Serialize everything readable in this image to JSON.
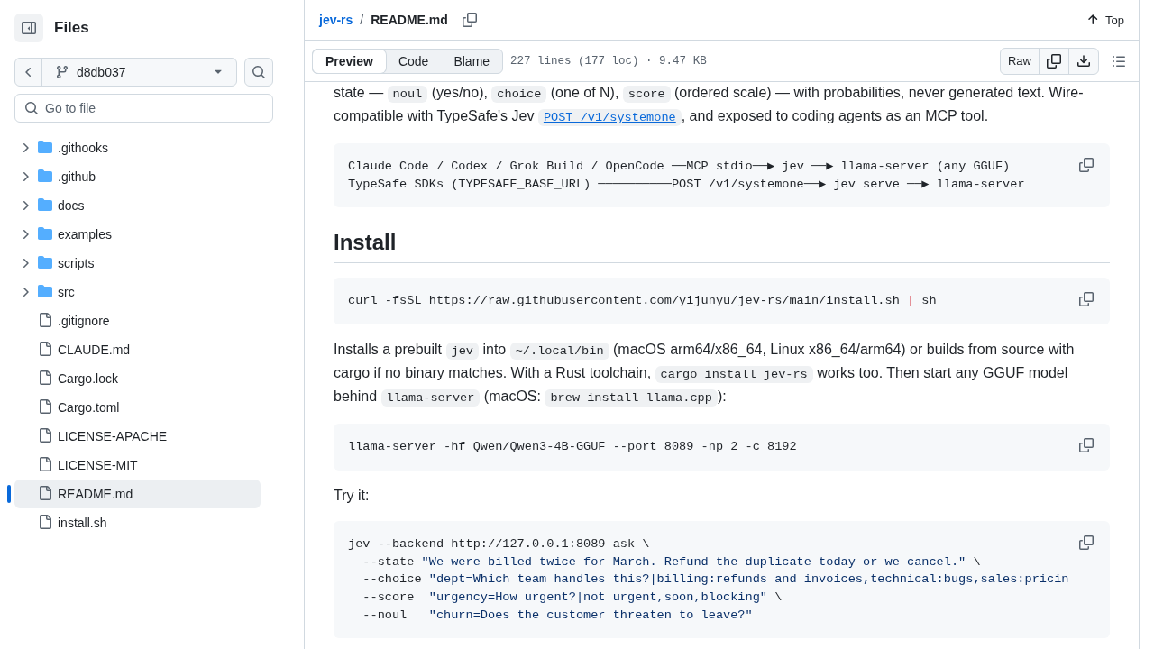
{
  "sidebar": {
    "title": "Files",
    "branch": "d8db037",
    "search": {
      "placeholder": "Go to file"
    },
    "items": [
      {
        "kind": "folder",
        "name": ".githooks",
        "expanded": false,
        "selected": false
      },
      {
        "kind": "folder",
        "name": ".github",
        "expanded": false,
        "selected": false
      },
      {
        "kind": "folder",
        "name": "docs",
        "expanded": false,
        "selected": false
      },
      {
        "kind": "folder",
        "name": "examples",
        "expanded": false,
        "selected": false
      },
      {
        "kind": "folder",
        "name": "scripts",
        "expanded": false,
        "selected": false
      },
      {
        "kind": "folder",
        "name": "src",
        "expanded": false,
        "selected": false
      },
      {
        "kind": "file",
        "name": ".gitignore",
        "selected": false
      },
      {
        "kind": "file",
        "name": "CLAUDE.md",
        "selected": false
      },
      {
        "kind": "file",
        "name": "Cargo.lock",
        "selected": false
      },
      {
        "kind": "file",
        "name": "Cargo.toml",
        "selected": false
      },
      {
        "kind": "file",
        "name": "LICENSE-APACHE",
        "selected": false
      },
      {
        "kind": "file",
        "name": "LICENSE-MIT",
        "selected": false
      },
      {
        "kind": "file",
        "name": "README.md",
        "selected": true
      },
      {
        "kind": "file",
        "name": "install.sh",
        "selected": false
      }
    ]
  },
  "file_view": {
    "breadcrumb": {
      "repo": "jev-rs",
      "separator": "/",
      "file": "README.md"
    },
    "top_link": "Top",
    "view_tabs": [
      {
        "label": "Preview",
        "selected": true
      },
      {
        "label": "Code",
        "selected": false
      },
      {
        "label": "Blame",
        "selected": false
      }
    ],
    "file_info": "227 lines (177 loc) · 9.47 KB",
    "raw_button": "Raw",
    "blocks": [
      {
        "kind": "paragraph",
        "segments": [
          {
            "kind": "text",
            "text": "state — "
          },
          {
            "kind": "code",
            "text": "noul"
          },
          {
            "kind": "text",
            "text": " (yes/no), "
          },
          {
            "kind": "code",
            "text": "choice"
          },
          {
            "kind": "text",
            "text": " (one of N), "
          },
          {
            "kind": "code",
            "text": "score"
          },
          {
            "kind": "text",
            "text": " (ordered scale) — with probabilities, never generated text. Wire-compatible with TypeSafe's Jev "
          },
          {
            "kind": "link_code",
            "text": "POST /v1/systemone"
          },
          {
            "kind": "text",
            "text": ", and exposed to coding agents as an MCP tool."
          }
        ]
      },
      {
        "kind": "code",
        "lines": [
          [
            {
              "kind": "plain",
              "text": "Claude Code / Codex / Grok Build / OpenCode ──MCP stdio──▶ jev ──▶ llama-server (any GGUF)"
            }
          ],
          [
            {
              "kind": "plain",
              "text": "TypeSafe SDKs (TYPESAFE_BASE_URL) ──────────POST /v1/systemone──▶ jev serve ──▶ llama-server"
            }
          ]
        ]
      },
      {
        "kind": "heading",
        "text": "Install"
      },
      {
        "kind": "code",
        "lines": [
          [
            {
              "kind": "plain",
              "text": "curl -fsSL https://raw.githubusercontent.com/yijunyu/jev-rs/main/install.sh "
            },
            {
              "kind": "operator",
              "text": "|"
            },
            {
              "kind": "plain",
              "text": " sh"
            }
          ]
        ]
      },
      {
        "kind": "paragraph",
        "segments": [
          {
            "kind": "text",
            "text": "Installs a prebuilt "
          },
          {
            "kind": "code",
            "text": "jev"
          },
          {
            "kind": "text",
            "text": " into "
          },
          {
            "kind": "code",
            "text": "~/.local/bin"
          },
          {
            "kind": "text",
            "text": " (macOS arm64/x86_64, Linux x86_64/arm64) or builds from source with cargo if no binary matches. With a Rust toolchain, "
          },
          {
            "kind": "code",
            "text": "cargo install jev-rs"
          },
          {
            "kind": "text",
            "text": " works too. Then start any GGUF model behind "
          },
          {
            "kind": "code",
            "text": "llama-server"
          },
          {
            "kind": "text",
            "text": " (macOS: "
          },
          {
            "kind": "code",
            "text": "brew install llama.cpp"
          },
          {
            "kind": "text",
            "text": "):"
          }
        ]
      },
      {
        "kind": "code",
        "lines": [
          [
            {
              "kind": "plain",
              "text": "llama-server -hf Qwen/Qwen3-4B-GGUF --port 8089 -np 2 -c 8192"
            }
          ]
        ]
      },
      {
        "kind": "paragraph",
        "segments": [
          {
            "kind": "text",
            "text": "Try it:"
          }
        ]
      },
      {
        "kind": "code",
        "lines": [
          [
            {
              "kind": "plain",
              "text": "jev --backend http://127.0.0.1:8089 ask \\"
            }
          ],
          [
            {
              "kind": "plain",
              "text": "  --state "
            },
            {
              "kind": "string",
              "text": "\"We were billed twice for March. Refund the duplicate today or we cancel.\""
            },
            {
              "kind": "plain",
              "text": " \\"
            }
          ],
          [
            {
              "kind": "plain",
              "text": "  --choice "
            },
            {
              "kind": "string",
              "text": "\"dept=Which team handles this?|billing:refunds and invoices,technical:bugs,sales:pricin"
            }
          ],
          [
            {
              "kind": "plain",
              "text": "  --score  "
            },
            {
              "kind": "string",
              "text": "\"urgency=How urgent?|not urgent,soon,blocking\""
            },
            {
              "kind": "plain",
              "text": " \\"
            }
          ],
          [
            {
              "kind": "plain",
              "text": "  --noul   "
            },
            {
              "kind": "string",
              "text": "\"churn=Does the customer threaten to leave?\""
            }
          ]
        ]
      }
    ]
  }
}
